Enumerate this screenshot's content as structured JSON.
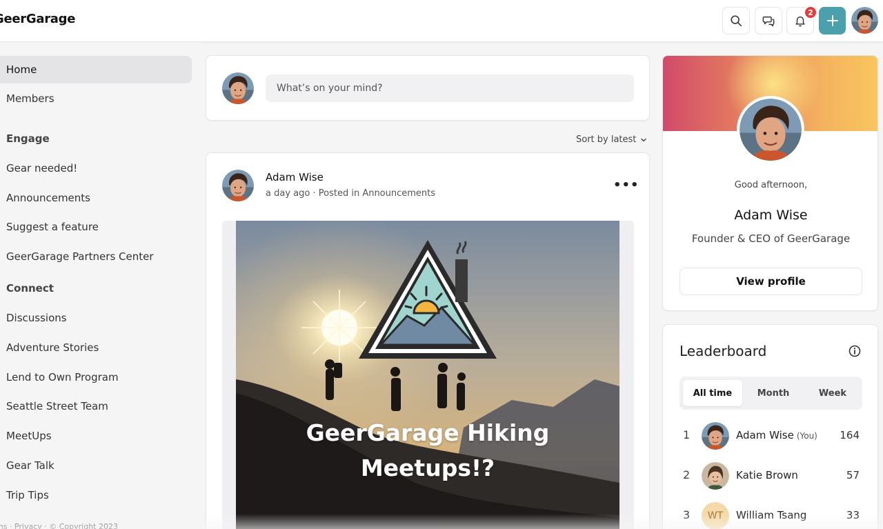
{
  "header": {
    "brand": "GeerGarage",
    "notification_count": "2",
    "icons": {
      "search": "search-icon",
      "messages": "chat-bubbles-icon",
      "notifications": "bell-icon",
      "create": "plus-icon"
    },
    "accent_color": "#4aa0ac"
  },
  "sidebar": {
    "items": [
      {
        "label": "Home",
        "active": true
      },
      {
        "label": "Members"
      }
    ],
    "engage": {
      "heading": "Engage",
      "items": [
        "Gear needed!",
        "Announcements",
        "Suggest a feature",
        "GeerGarage Partners Center"
      ]
    },
    "connect": {
      "heading": "Connect",
      "items": [
        "Discussions",
        "Adventure Stories",
        "Lend to Own Program",
        "Seattle Street Team",
        "MeetUps",
        "Gear Talk",
        "Trip Tips"
      ]
    },
    "footer": "ms · Privacy · © Copyright 2023"
  },
  "composer": {
    "placeholder": "What’s on your mind?"
  },
  "feed": {
    "sort_label": "Sort by latest"
  },
  "post": {
    "author": "Adam Wise",
    "meta_time": "a day ago",
    "meta_separator": "·",
    "meta_posted_in": "Posted in Announcements",
    "image_title_line1": "GeerGarage Hiking",
    "image_title_line2": "Meetups!?"
  },
  "profile": {
    "greeting": "Good afternoon,",
    "name": "Adam Wise",
    "role": "Founder & CEO of GeerGarage",
    "button": "View profile"
  },
  "leaderboard": {
    "title": "Leaderboard",
    "tabs": [
      "All time",
      "Month",
      "Week"
    ],
    "active_tab": "All time",
    "rows": [
      {
        "rank": "1",
        "name": "Adam Wise",
        "you": "(You)",
        "score": "164"
      },
      {
        "rank": "2",
        "name": "Katie Brown",
        "you": "",
        "score": "57"
      },
      {
        "rank": "3",
        "name": "William Tsang",
        "initials": "WT",
        "you": "",
        "score": "33"
      }
    ]
  }
}
